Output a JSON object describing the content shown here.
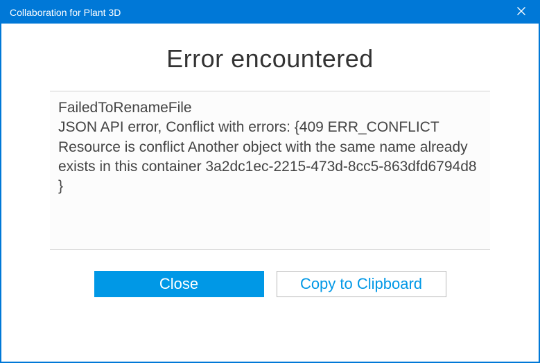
{
  "titlebar": {
    "title": "Collaboration for Plant 3D"
  },
  "dialog": {
    "heading": "Error encountered",
    "error_message": "FailedToRenameFile\nJSON API error, Conflict with errors: {409 ERR_CONFLICT Resource is conflict Another object with the same name already exists in this container 3a2dc1ec-2215-473d-8cc5-863dfd6794d8 }"
  },
  "buttons": {
    "close_label": "Close",
    "copy_label": "Copy to Clipboard"
  }
}
